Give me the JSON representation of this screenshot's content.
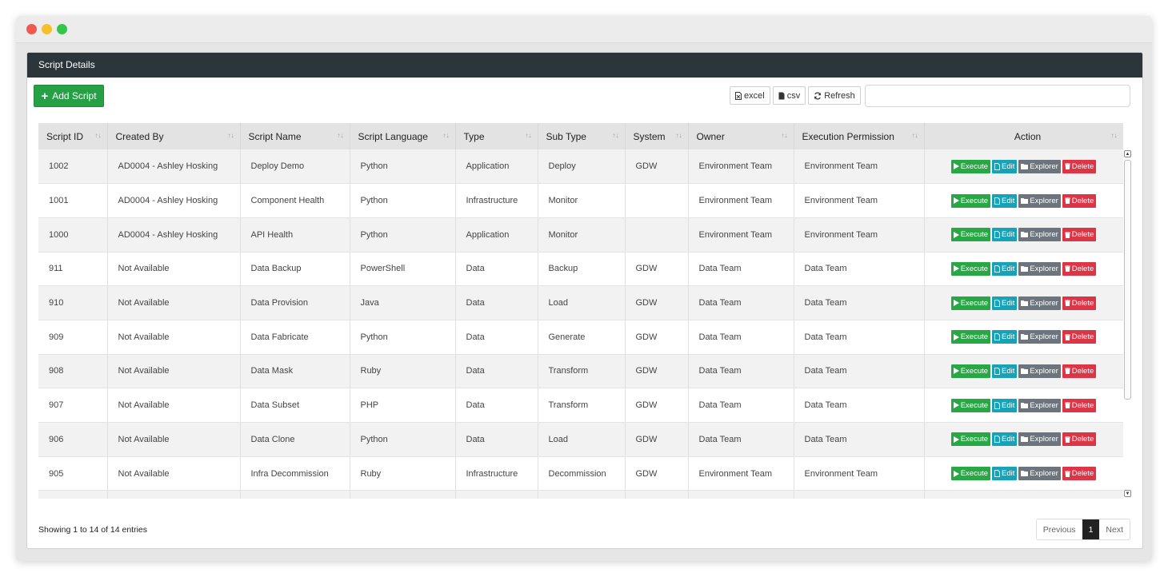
{
  "colors": {
    "header_bg": "#2b363b",
    "success": "#28a745",
    "info": "#17a2b8",
    "secondary": "#6c757d",
    "danger": "#dc3545"
  },
  "window": {
    "dots": [
      "#ee5a52",
      "#f5bf2e",
      "#33c748"
    ]
  },
  "panel": {
    "title": "Script Details"
  },
  "toolbar": {
    "add_icon": "plus-icon",
    "add_label": "Add Script",
    "excel_label": "excel",
    "csv_label": "csv",
    "refresh_label": "Refresh",
    "search_value": ""
  },
  "table": {
    "columns": [
      "Script ID",
      "Created By",
      "Script Name",
      "Script Language",
      "Type",
      "Sub Type",
      "System",
      "Owner",
      "Execution Permission",
      "Action"
    ],
    "action_labels": {
      "execute": "Execute",
      "edit": "Edit",
      "explorer": "Explorer",
      "delete": "Delete"
    },
    "rows": [
      [
        "1002",
        "AD0004 - Ashley Hosking",
        "Deploy Demo",
        "Python",
        "Application",
        "Deploy",
        "GDW",
        "Environment Team",
        "Environment Team"
      ],
      [
        "1001",
        "AD0004 - Ashley Hosking",
        "Component Health",
        "Python",
        "Infrastructure",
        "Monitor",
        "",
        "Environment Team",
        "Environment Team"
      ],
      [
        "1000",
        "AD0004 - Ashley Hosking",
        "API Health",
        "Python",
        "Application",
        "Monitor",
        "",
        "Environment Team",
        "Environment Team"
      ],
      [
        "911",
        "Not Available",
        "Data Backup",
        "PowerShell",
        "Data",
        "Backup",
        "GDW",
        "Data Team",
        "Data Team"
      ],
      [
        "910",
        "Not Available",
        "Data Provision",
        "Java",
        "Data",
        "Load",
        "GDW",
        "Data Team",
        "Data Team"
      ],
      [
        "909",
        "Not Available",
        "Data Fabricate",
        "Python",
        "Data",
        "Generate",
        "GDW",
        "Data Team",
        "Data Team"
      ],
      [
        "908",
        "Not Available",
        "Data Mask",
        "Ruby",
        "Data",
        "Transform",
        "GDW",
        "Data Team",
        "Data Team"
      ],
      [
        "907",
        "Not Available",
        "Data Subset",
        "PHP",
        "Data",
        "Transform",
        "GDW",
        "Data Team",
        "Data Team"
      ],
      [
        "906",
        "Not Available",
        "Data Clone",
        "Python",
        "Data",
        "Load",
        "GDW",
        "Data Team",
        "Data Team"
      ],
      [
        "905",
        "Not Available",
        "Infra Decommission",
        "Ruby",
        "Infrastructure",
        "Decommission",
        "GDW",
        "Environment Team",
        "Environment Team"
      ]
    ]
  },
  "footer": {
    "info": "Showing 1 to 14 of 14 entries",
    "previous": "Previous",
    "page": "1",
    "next": "Next"
  }
}
